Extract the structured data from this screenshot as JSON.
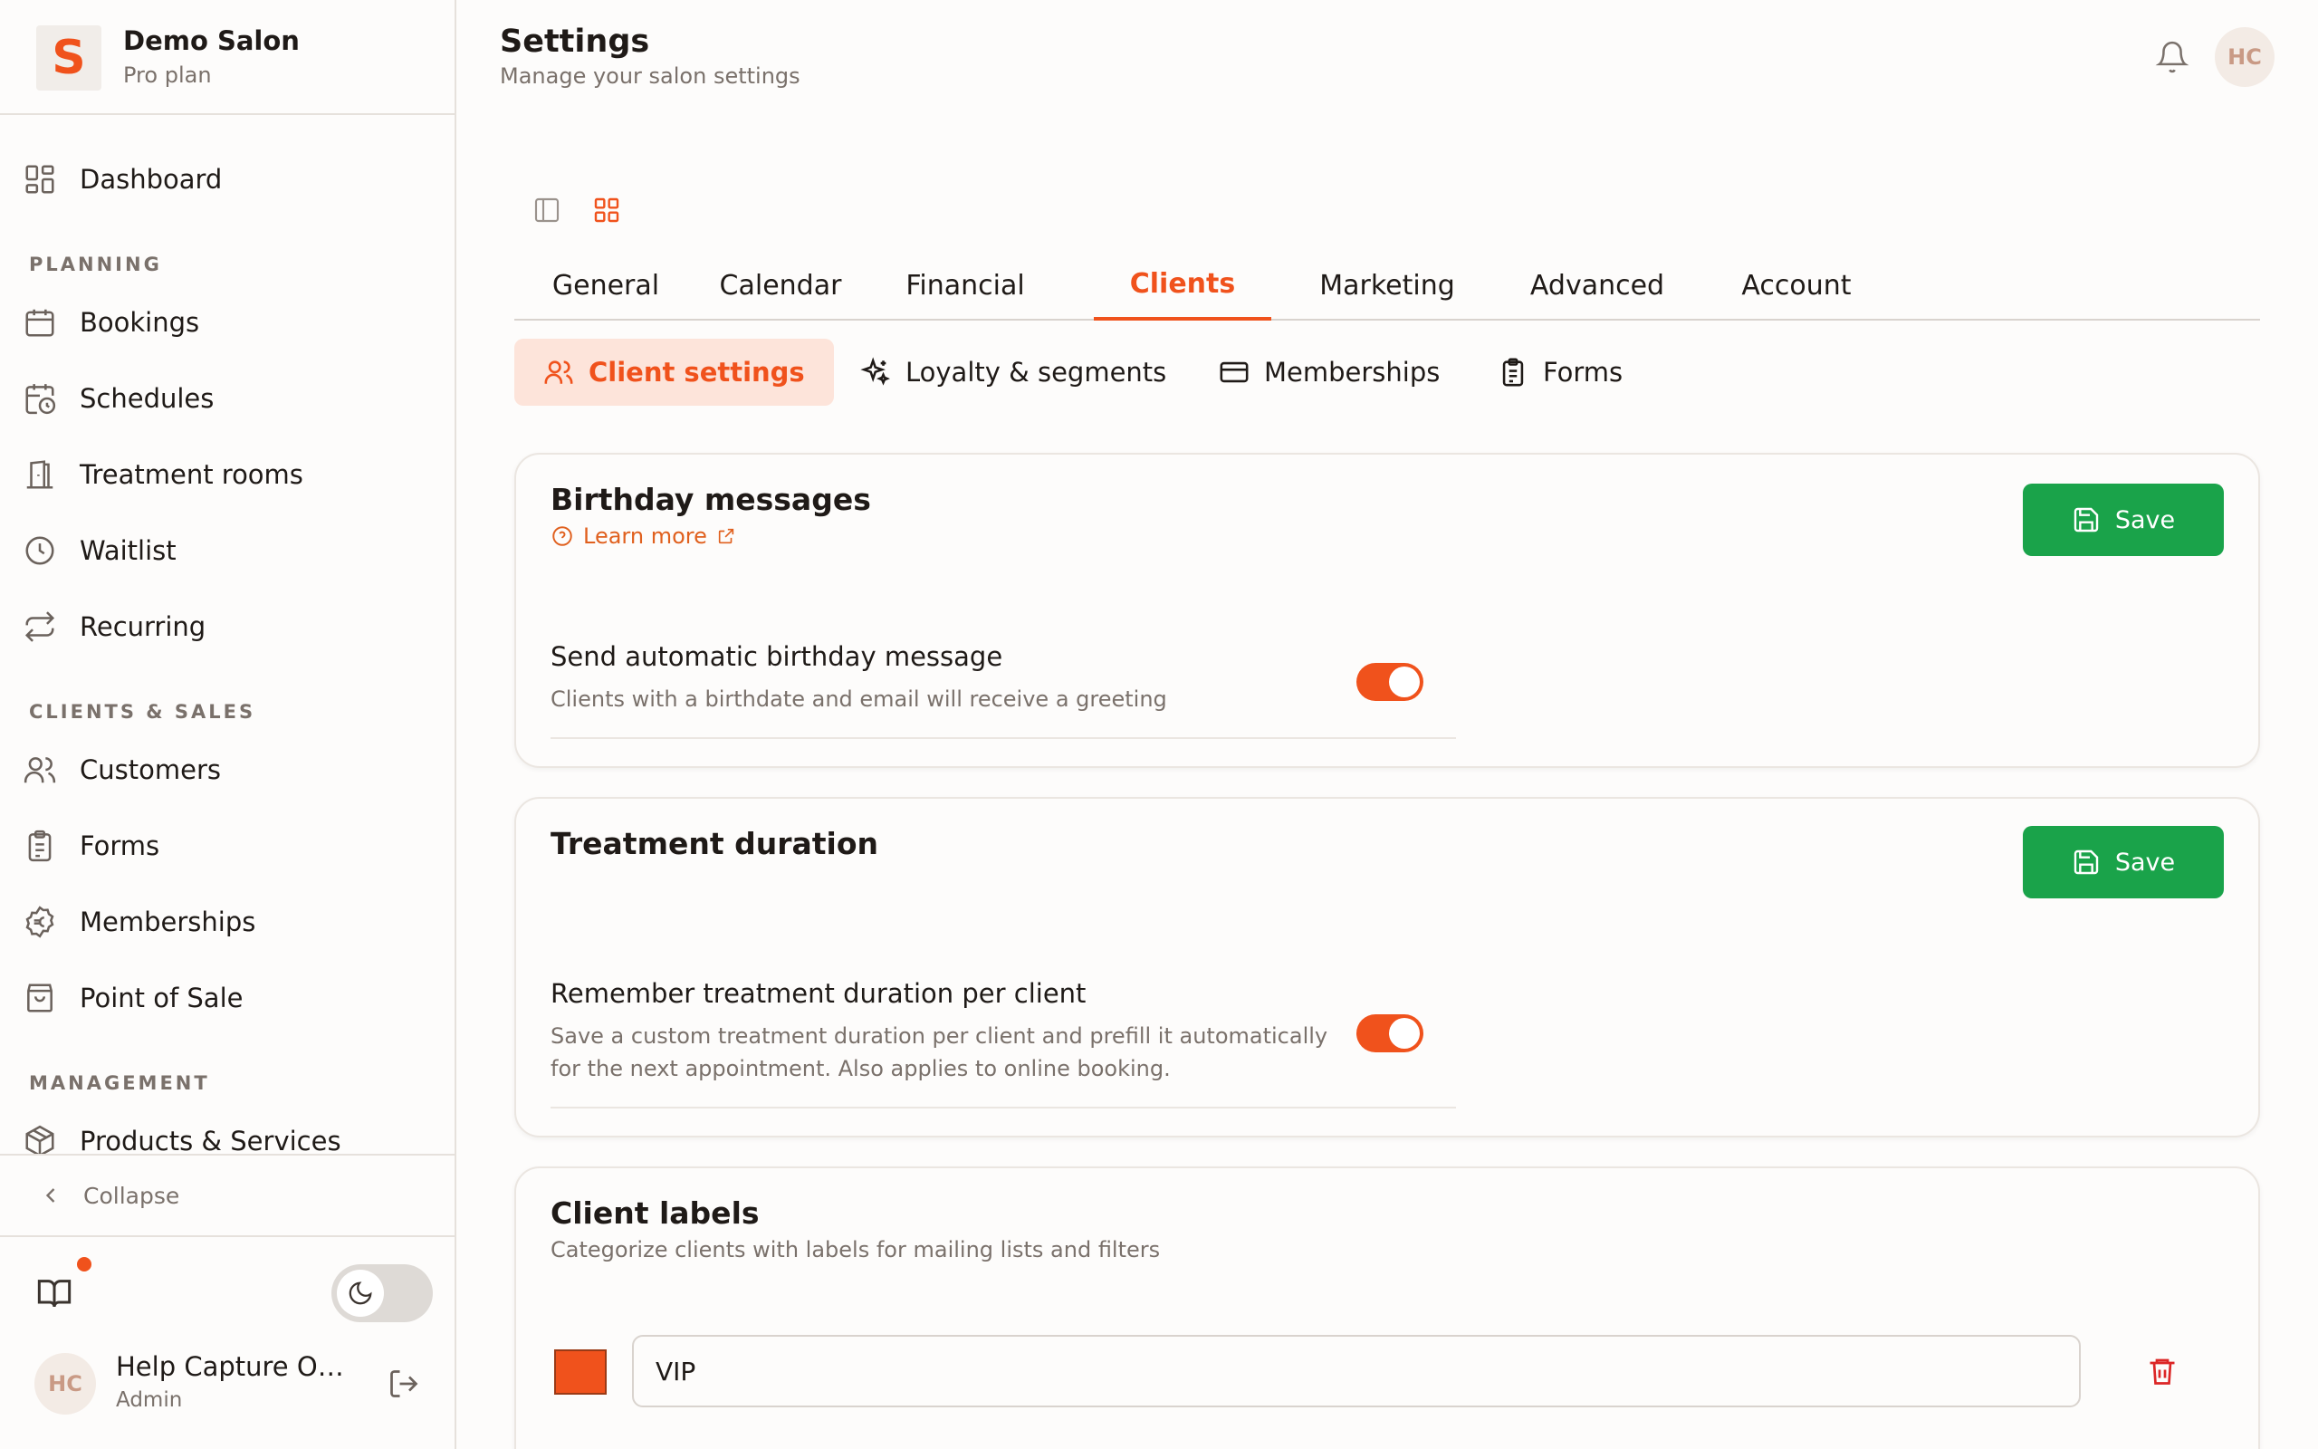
{
  "brand": {
    "logo_letter": "S",
    "name": "Demo Salon",
    "plan": "Pro plan"
  },
  "sidebar": {
    "dashboard": "Dashboard",
    "sections": {
      "planning": "PLANNING",
      "clients_sales": "CLIENTS & SALES",
      "management": "MANAGEMENT"
    },
    "items": {
      "bookings": "Bookings",
      "schedules": "Schedules",
      "treatment_rooms": "Treatment rooms",
      "waitlist": "Waitlist",
      "recurring": "Recurring",
      "customers": "Customers",
      "forms": "Forms",
      "memberships": "Memberships",
      "point_of_sale": "Point of Sale",
      "products_services": "Products & Services"
    },
    "collapse": "Collapse",
    "user": {
      "initials": "HC",
      "name": "Help Capture Ow...",
      "role": "Admin"
    }
  },
  "header": {
    "title": "Settings",
    "subtitle": "Manage your salon settings",
    "avatar_initials": "HC"
  },
  "tabs": [
    "General",
    "Calendar",
    "Financial",
    "Clients",
    "Marketing",
    "Advanced",
    "Account"
  ],
  "active_tab": "Clients",
  "subtabs": [
    "Client settings",
    "Loyalty & segments",
    "Memberships",
    "Forms"
  ],
  "active_subtab": "Client settings",
  "cards": {
    "birthday": {
      "title": "Birthday messages",
      "learn_more": "Learn more",
      "save": "Save",
      "setting_label": "Send automatic birthday message",
      "setting_desc": "Clients with a birthdate and email will receive a greeting",
      "enabled": true
    },
    "duration": {
      "title": "Treatment duration",
      "save": "Save",
      "setting_label": "Remember treatment duration per client",
      "setting_desc": "Save a custom treatment duration per client and prefill it automatically for the next appointment. Also applies to online booking.",
      "enabled": true
    },
    "labels": {
      "title": "Client labels",
      "subtitle": "Categorize clients with labels for mailing lists and filters",
      "items": [
        {
          "name": "VIP",
          "color": "#f0521c"
        }
      ]
    }
  },
  "colors": {
    "accent": "#f0521c",
    "save": "#1aa34a",
    "danger": "#dc2626"
  }
}
